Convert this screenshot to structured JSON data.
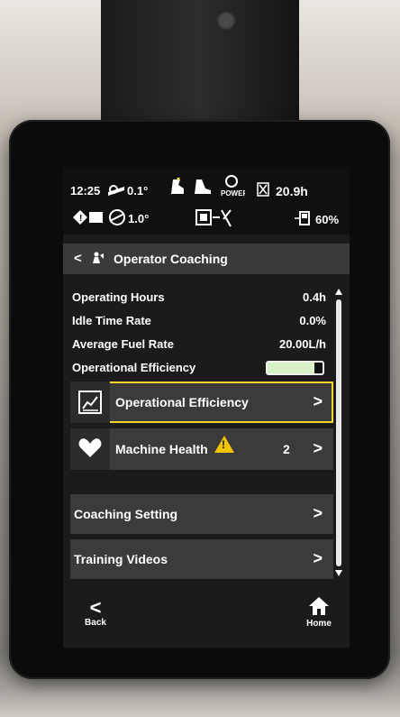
{
  "status_bar": {
    "time": "12:25",
    "tilt_top": "0.1°",
    "engine_hours": "20.9h",
    "tilt_bottom": "1.0°",
    "fuel_level": "60%"
  },
  "header": {
    "title": "Operator Coaching"
  },
  "metrics": [
    {
      "label": "Operating Hours",
      "value": "0.4h"
    },
    {
      "label": "Idle Time Rate",
      "value": "0.0%"
    },
    {
      "label": "Average Fuel Rate",
      "value": "20.00L/h"
    },
    {
      "label": "Operational Efficiency",
      "level": 0.85
    }
  ],
  "cards": {
    "operational_efficiency": {
      "label": "Operational Efficiency"
    },
    "machine_health": {
      "label": "Machine Health",
      "count": "2"
    }
  },
  "menu": [
    {
      "label": "Coaching Setting"
    },
    {
      "label": "Training Videos"
    }
  ],
  "nav": {
    "back_label": "Back",
    "home_label": "Home"
  },
  "colors": {
    "highlight": "#f3d62e",
    "warning": "#f0c400",
    "efficiency_fill": "#d8f2c8"
  }
}
